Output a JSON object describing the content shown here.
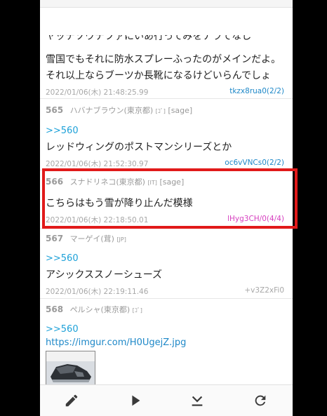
{
  "earlier_post": {
    "cut_line": "ヤッテゾウテファにいあ行ってみをナラてなし",
    "lines": [
      "雪国でもそれに防水スプレーふったのがメインだよ。",
      "それ以上ならブーツか長靴になるけどいらんでしょ"
    ],
    "date": "2022/01/06(木) 21:48:25.99",
    "id": "tkzx8rua0(2/2)"
  },
  "posts": [
    {
      "number": "565",
      "name": "ハバナブラウン(東京都)",
      "tag": "[ｺﾞ]",
      "sage": "[sage]",
      "anchor": ">>560",
      "text": "レッドウィングのポストマンシリーズとか",
      "date": "2022/01/06(木) 21:52:30.97",
      "id": "oc6vVNCs0(2/2)"
    },
    {
      "number": "566",
      "name": "スナドリネコ(東京都)",
      "tag": "[IT]",
      "sage": "[sage]",
      "text": "こちらはもう雪が降り止んだ模様",
      "date": "2022/01/06(木) 22:18:50.01",
      "id": "lHyg3CH/0(4/4)"
    },
    {
      "number": "567",
      "name": "マーゲイ(茸)",
      "tag": "[JP]",
      "anchor": ">>560",
      "text": "アシックススノーシューズ",
      "date": "2022/01/06(木) 22:19:11.46",
      "id": "+v3Z2xFi0"
    },
    {
      "number": "568",
      "name": "ペルシャ(東京都)",
      "tag": "[ｺﾞ]",
      "anchor": ">>560",
      "link": "https://imgur.com/H0UgejZ.jpg"
    }
  ],
  "toolbar": {
    "icons": [
      "pencil-icon",
      "play-icon",
      "download-icon",
      "refresh-icon"
    ]
  },
  "colors": {
    "anchor": "#1da1d8",
    "link": "#1e88c8",
    "highlight": "#e11a1a",
    "id_magenta": "#d63fbf"
  }
}
